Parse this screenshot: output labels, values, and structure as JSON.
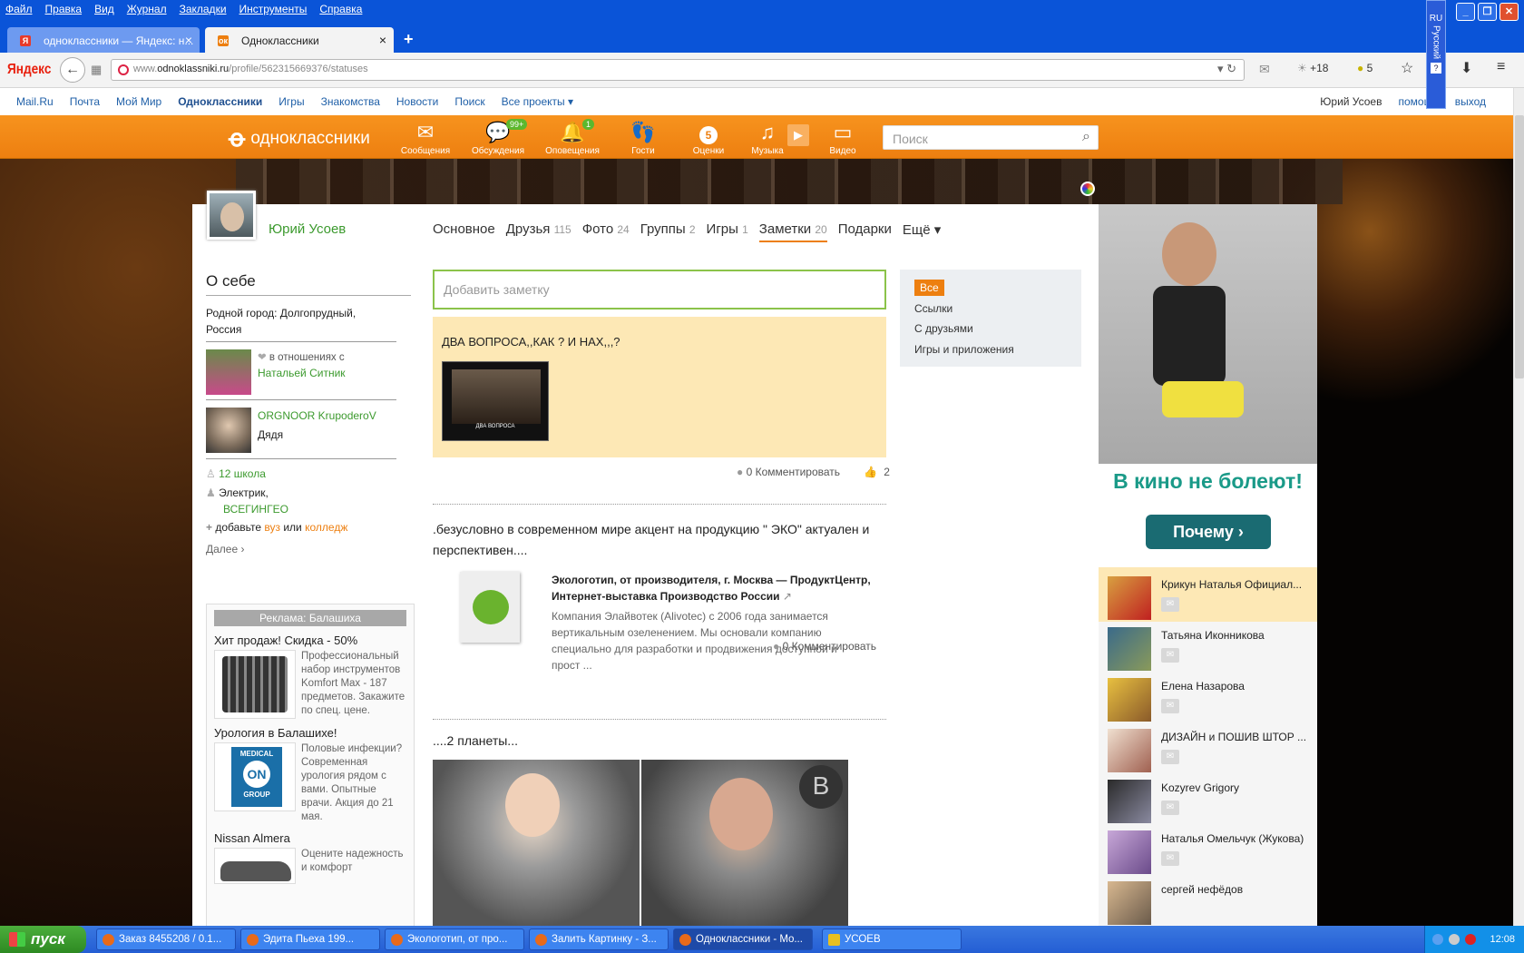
{
  "browser": {
    "menus": [
      "Файл",
      "Правка",
      "Вид",
      "Журнал",
      "Закладки",
      "Инструменты",
      "Справка"
    ],
    "tabs": [
      {
        "title": "одноклассники — Яндекс: н...",
        "active": false
      },
      {
        "title": "Одноклассники",
        "active": true
      }
    ],
    "new_tab": "+",
    "yandex_logo": "Яндекс",
    "url_prefix": "www.",
    "url_domain": "odnoklassniki.ru",
    "url_path": "/profile/562315669376/statuses",
    "weather": "+18",
    "bar_count": "5",
    "lang": "RU",
    "lang_name": "Русский"
  },
  "portal": {
    "links": [
      "Mail.Ru",
      "Почта",
      "Мой Мир",
      "Одноклассники",
      "Игры",
      "Знакомства",
      "Новости",
      "Поиск",
      "Все проекты ▾"
    ],
    "user": "Юрий Усоев",
    "help": "помощь",
    "logout": "выход"
  },
  "ok": {
    "logo": "одноклассники",
    "nav": [
      {
        "label": "Сообщения",
        "icon": "envelope-icon",
        "badge": ""
      },
      {
        "label": "Обсуждения",
        "icon": "chat-icon",
        "badge": "99+"
      },
      {
        "label": "Оповещения",
        "icon": "bell-icon",
        "badge": "1"
      },
      {
        "label": "Гости",
        "icon": "footprints-icon",
        "badge": ""
      },
      {
        "label": "Оценки",
        "icon": "rating-icon",
        "badge": "5"
      },
      {
        "label": "Музыка",
        "icon": "music-icon",
        "badge": ""
      },
      {
        "label": "Видео",
        "icon": "video-icon",
        "badge": ""
      }
    ],
    "search_placeholder": "Поиск"
  },
  "profile": {
    "name": "Юрий Усоев",
    "tabs": [
      {
        "label": "Основное",
        "count": ""
      },
      {
        "label": "Друзья",
        "count": "115"
      },
      {
        "label": "Фото",
        "count": "24"
      },
      {
        "label": "Группы",
        "count": "2"
      },
      {
        "label": "Игры",
        "count": "1"
      },
      {
        "label": "Заметки",
        "count": "20"
      },
      {
        "label": "Подарки",
        "count": ""
      },
      {
        "label": "Ещё ▾",
        "count": ""
      }
    ]
  },
  "about": {
    "title": "О себе",
    "hometown": "Родной город: Долгопрудный, Россия",
    "relation_label": "в отношениях с",
    "relation_name": "Натальей Ситник",
    "friend_name": "ORGNOOR KrupoderoV",
    "friend_role": "Дядя",
    "school": "12 школа",
    "job": "Электрик,",
    "company": "ВСЕГИНГЕО",
    "add_text": "добавьте",
    "add_vuz": "вуз",
    "add_or": "или",
    "add_college": "колледж",
    "more": "Далее ›"
  },
  "ads_left": {
    "header": "Реклама: Балашиха",
    "items": [
      {
        "title": "Хит продаж! Скидка - 50%",
        "text": "Профессиональный набор инструментов Komfort Max - 187 предметов. Закажите по спец. цене."
      },
      {
        "title": "Урология в Балашихе!",
        "text": "Половые инфекции? Современная урология рядом с вами. Опытные врачи. Акция до 21 мая."
      },
      {
        "title": "Nissan Almera",
        "text": "Оцените надежность и комфорт"
      }
    ],
    "logo_medical": "MEDICAL",
    "logo_on": "ON",
    "logo_group": "GROUP"
  },
  "notes": {
    "add_placeholder": "Добавить заметку",
    "post1_title": "ДВА ВОПРОСА,,КАК ? И НАХ,,,?",
    "post1_caption": "ДВА ВОПРОСА",
    "post1_comments": "0 Комментировать",
    "post1_likes": "2",
    "post2_text": ".безусловно в современном мире акцент на продукцию \" ЭКО\" актуален и перспективен....",
    "post2_link_title": "Экологотип, от производителя, г. Москва — ПродуктЦентр, Интернет-выставка Производство России",
    "post2_link_desc": "Компания Элайвотек (Alivotec) с 2006 года занимается вертикальным озеленением. Мы основали компанию специально для разработки и продвижения доступной и прост ...",
    "post2_comments": "0 Комментировать",
    "post3_text": "....2 планеты..."
  },
  "filter": {
    "items": [
      "Все",
      "Ссылки",
      "С друзьями",
      "Игры и приложения"
    ],
    "selected": "Все"
  },
  "ad_right": {
    "slogan": "В кино не болеют!",
    "button": "Почему ›"
  },
  "friends_online": [
    "Крикун Наталья Официал...",
    "Татьяна Иконникова",
    "Елена Назарова",
    "ДИЗАЙН и ПОШИВ ШТОР ...",
    "Kozyrev Grigory",
    "Наталья Омельчук (Жукова)",
    "сергей нефёдов"
  ],
  "taskbar": {
    "start": "пуск",
    "items": [
      "Заказ 8455208 / 0.1...",
      "Эдита Пьеха 199...",
      "Экологотип, от про...",
      "Залить Картинку - З...",
      "Одноклассники - Mo...",
      "УСОЕВ"
    ],
    "clock": "12:08"
  },
  "colors": {
    "ok_orange": "#ed7f10",
    "ok_green": "#3c9a2e",
    "xp_blue": "#0a54d8"
  }
}
